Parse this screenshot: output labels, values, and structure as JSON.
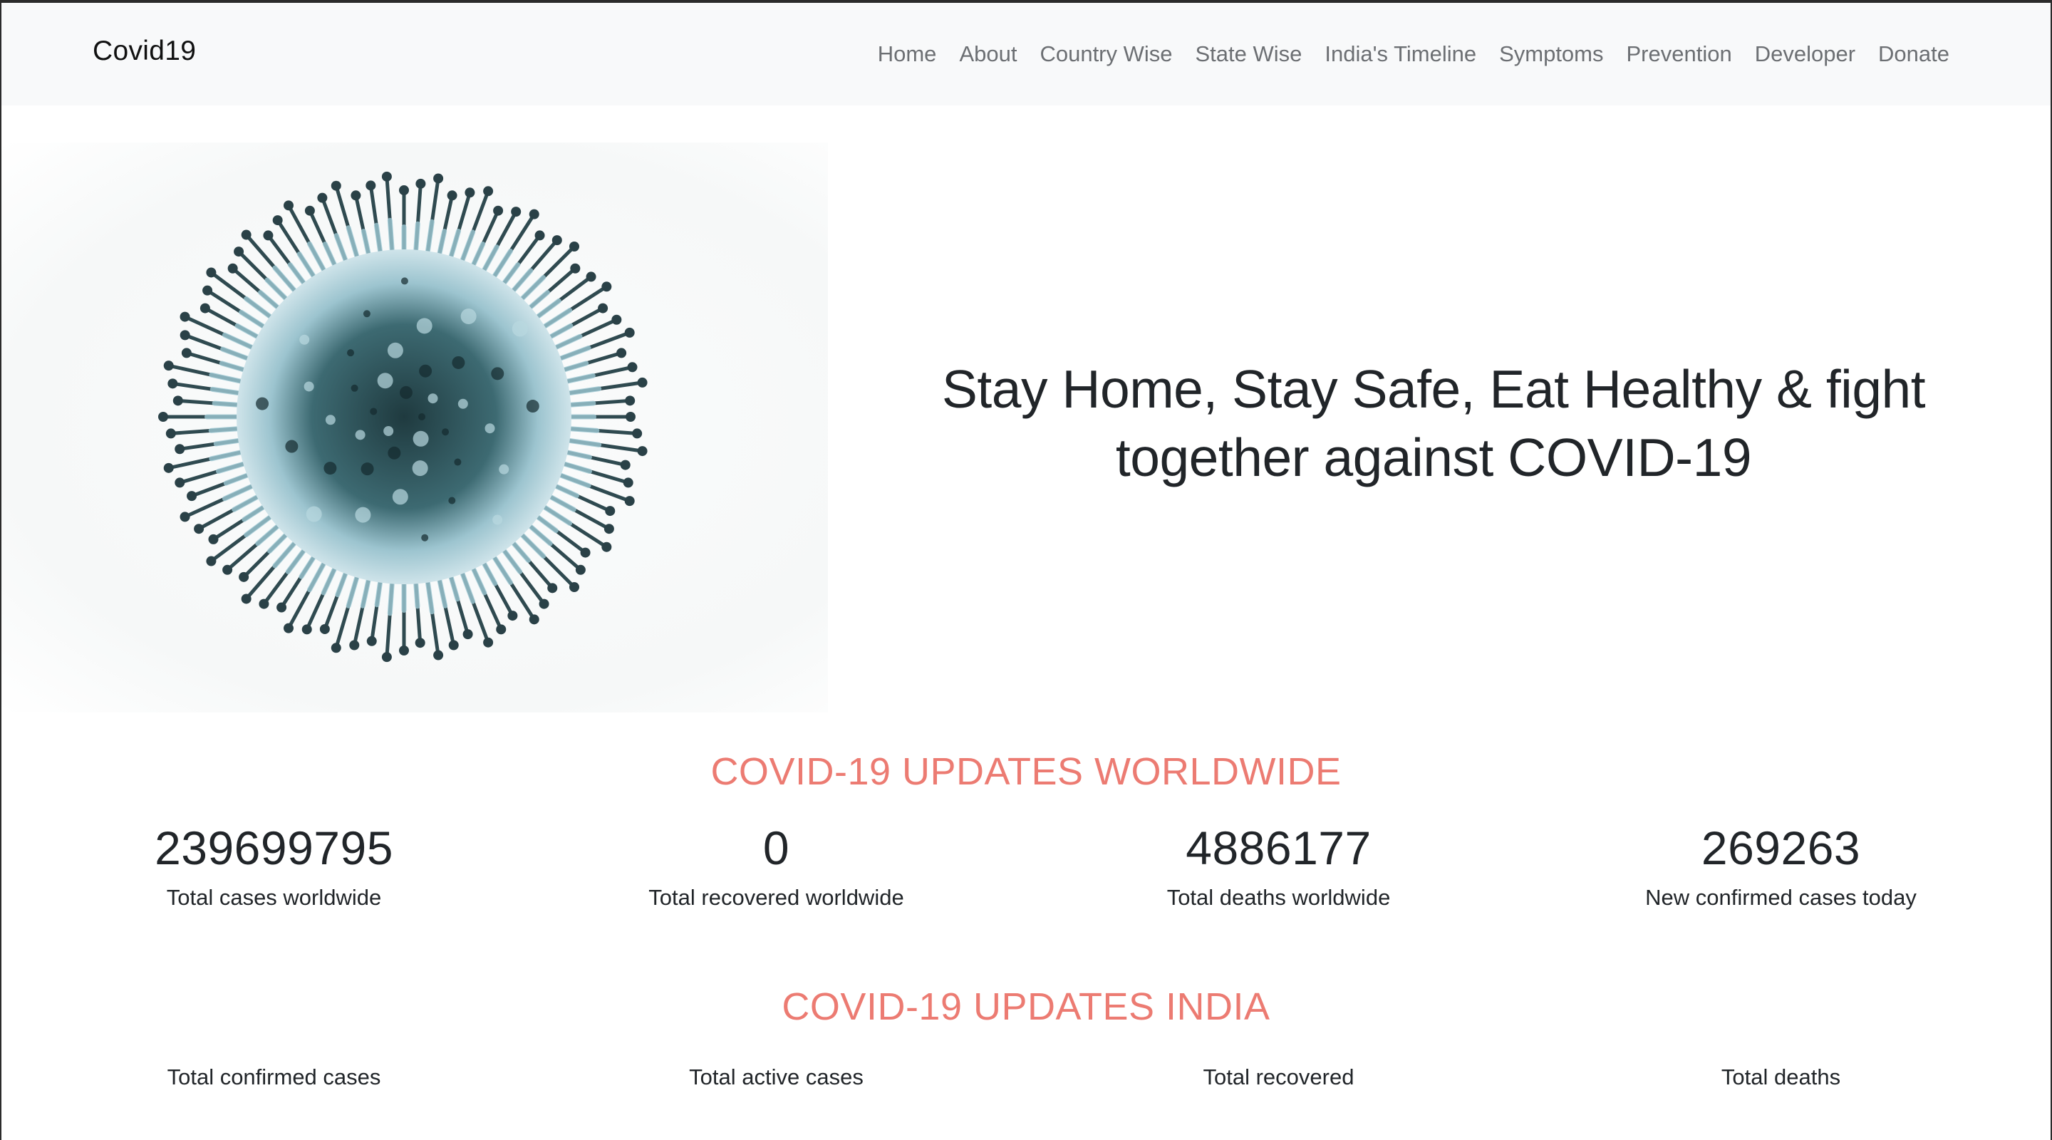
{
  "navbar": {
    "brand": "Covid19",
    "links": [
      "Home",
      "About",
      "Country Wise",
      "State Wise",
      "India's Timeline",
      "Symptoms",
      "Prevention",
      "Developer",
      "Donate"
    ]
  },
  "hero": {
    "headline_line1": "Stay Home, Stay Safe, Eat Healthy & fight",
    "headline_line2": "together against COVID-19"
  },
  "worldwide": {
    "title": "COVID-19 UPDATES WORLDWIDE",
    "stats": [
      {
        "value": "239699795",
        "label": "Total cases worldwide"
      },
      {
        "value": "0",
        "label": "Total recovered worldwide"
      },
      {
        "value": "4886177",
        "label": "Total deaths worldwide"
      },
      {
        "value": "269263",
        "label": "New confirmed cases today"
      }
    ]
  },
  "india": {
    "title": "COVID-19 UPDATES INDIA",
    "stats": [
      {
        "value": "",
        "label": "Total confirmed cases"
      },
      {
        "value": "",
        "label": "Total active cases"
      },
      {
        "value": "",
        "label": "Total recovered"
      },
      {
        "value": "",
        "label": "Total deaths"
      }
    ]
  },
  "colors": {
    "navbar_bg": "#f8f9fa",
    "accent_red": "#ec7b72",
    "text_dark": "#212529",
    "nav_link": "#6c6f73",
    "virus_body": "#1f3a3f",
    "virus_spike": "#9ec9d4"
  }
}
